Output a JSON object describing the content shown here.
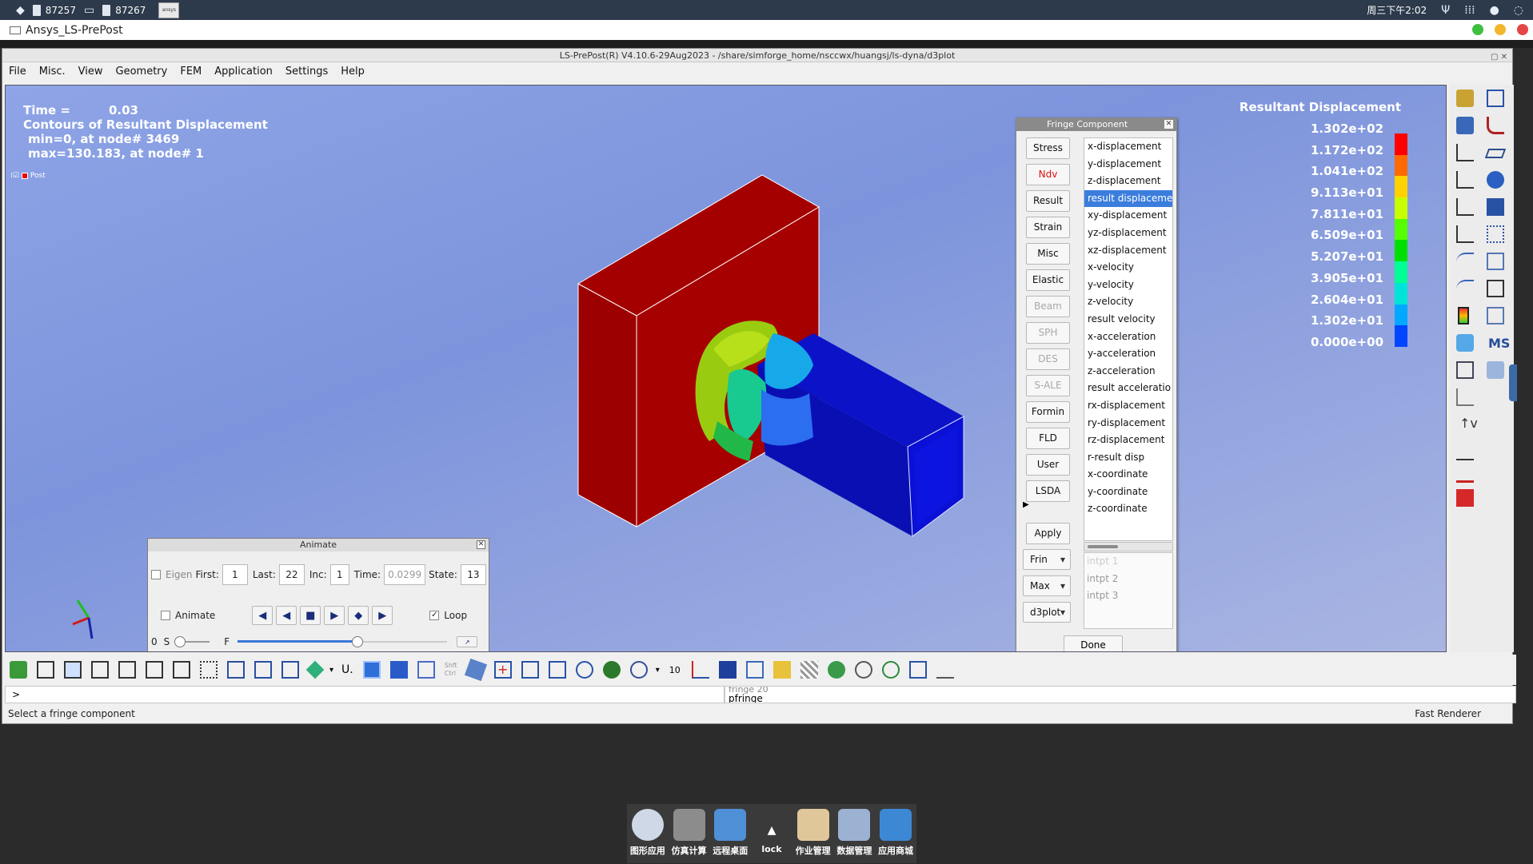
{
  "sysbar": {
    "task1": "87257",
    "task2": "87267",
    "ansys_label": "ansys",
    "clock": "周三下午2:02"
  },
  "app": {
    "title": "Ansys_LS-PrePost"
  },
  "lswindow": {
    "title": "LS-PrePost(R) V4.10.6-29Aug2023 - /share/simforge_home/nsccwx/huangsj/ls-dyna/d3plot",
    "menu": [
      "File",
      "Misc.",
      "View",
      "Geometry",
      "FEM",
      "Application",
      "Settings",
      "Help"
    ]
  },
  "viewport": {
    "time_label": "Time =",
    "time_value": "0.03",
    "contour_title": "Contours of Resultant Displacement",
    "min_line": "min=0, at node# 3469",
    "max_line": "max=130.183, at node# 1",
    "part_tag": "Post"
  },
  "legend": {
    "title": "Resultant Displacement",
    "values": [
      "1.302e+02",
      "1.172e+02",
      "1.041e+02",
      "9.113e+01",
      "7.811e+01",
      "6.509e+01",
      "5.207e+01",
      "3.905e+01",
      "2.604e+01",
      "1.302e+01",
      "0.000e+00"
    ],
    "colors": [
      "#ff0000",
      "#ff6a00",
      "#ffd200",
      "#c8ff00",
      "#55ff00",
      "#00e000",
      "#00ff95",
      "#00e4d8",
      "#00a8ff",
      "#0045ff",
      "#0000e6"
    ]
  },
  "fringe": {
    "title": "Fringe Component",
    "buttons": [
      "Stress",
      "Ndv",
      "Result",
      "Strain",
      "Misc",
      "Elastic",
      "Beam",
      "SPH",
      "DES",
      "S-ALE",
      "Formin",
      "FLD",
      "User",
      "LSDA"
    ],
    "list": [
      "x-displacement",
      "y-displacement",
      "z-displacement",
      "result displaceme",
      "xy-displacement",
      "yz-displacement",
      "xz-displacement",
      "x-velocity",
      "y-velocity",
      "z-velocity",
      "result velocity",
      "x-acceleration",
      "y-acceleration",
      "z-acceleration",
      "result acceleratio",
      "rx-displacement",
      "ry-displacement",
      "rz-displacement",
      "r-result disp",
      "x-coordinate",
      "y-coordinate",
      "z-coordinate"
    ],
    "selected_index": 3,
    "apply_label": "Apply",
    "drop1": "Frin",
    "drop2": "Max",
    "drop3": "d3plot",
    "intpts": [
      "intpt   1",
      "intpt   2",
      "intpt   3"
    ],
    "done_label": "Done"
  },
  "animate": {
    "title": "Animate",
    "eigen_label": "Eigen",
    "first_label": "First:",
    "first_value": "1",
    "last_label": "Last:",
    "last_value": "22",
    "inc_label": "Inc:",
    "inc_value": "1",
    "time_label": "Time:",
    "time_value": "0.0299",
    "state_label": "State:",
    "state_value": "13",
    "animate_label": "Animate",
    "loop_label": "Loop",
    "speed_zero": "0",
    "slow_label": "S",
    "fast_label": "F",
    "slider_level": 0.57
  },
  "bottom": {
    "zoom_value": "10",
    "shift_ctrl": "Shft\nCtrl",
    "cmd_prompt": ">",
    "history_prev": "fringe 20",
    "history_cur": "pfringe",
    "status_left": "Select a fringe component",
    "status_right": "Fast Renderer"
  },
  "dock": {
    "items": [
      "图形应用",
      "仿真计算",
      "远程桌面",
      "lock",
      "作业管理",
      "数据管理",
      "应用商城"
    ],
    "colors": [
      "#cfd8e6",
      "#8c8c8c",
      "#4f8fd6",
      "#3a3a3a",
      "#e0c79a",
      "#9cb2d2",
      "#3d88d4"
    ]
  }
}
